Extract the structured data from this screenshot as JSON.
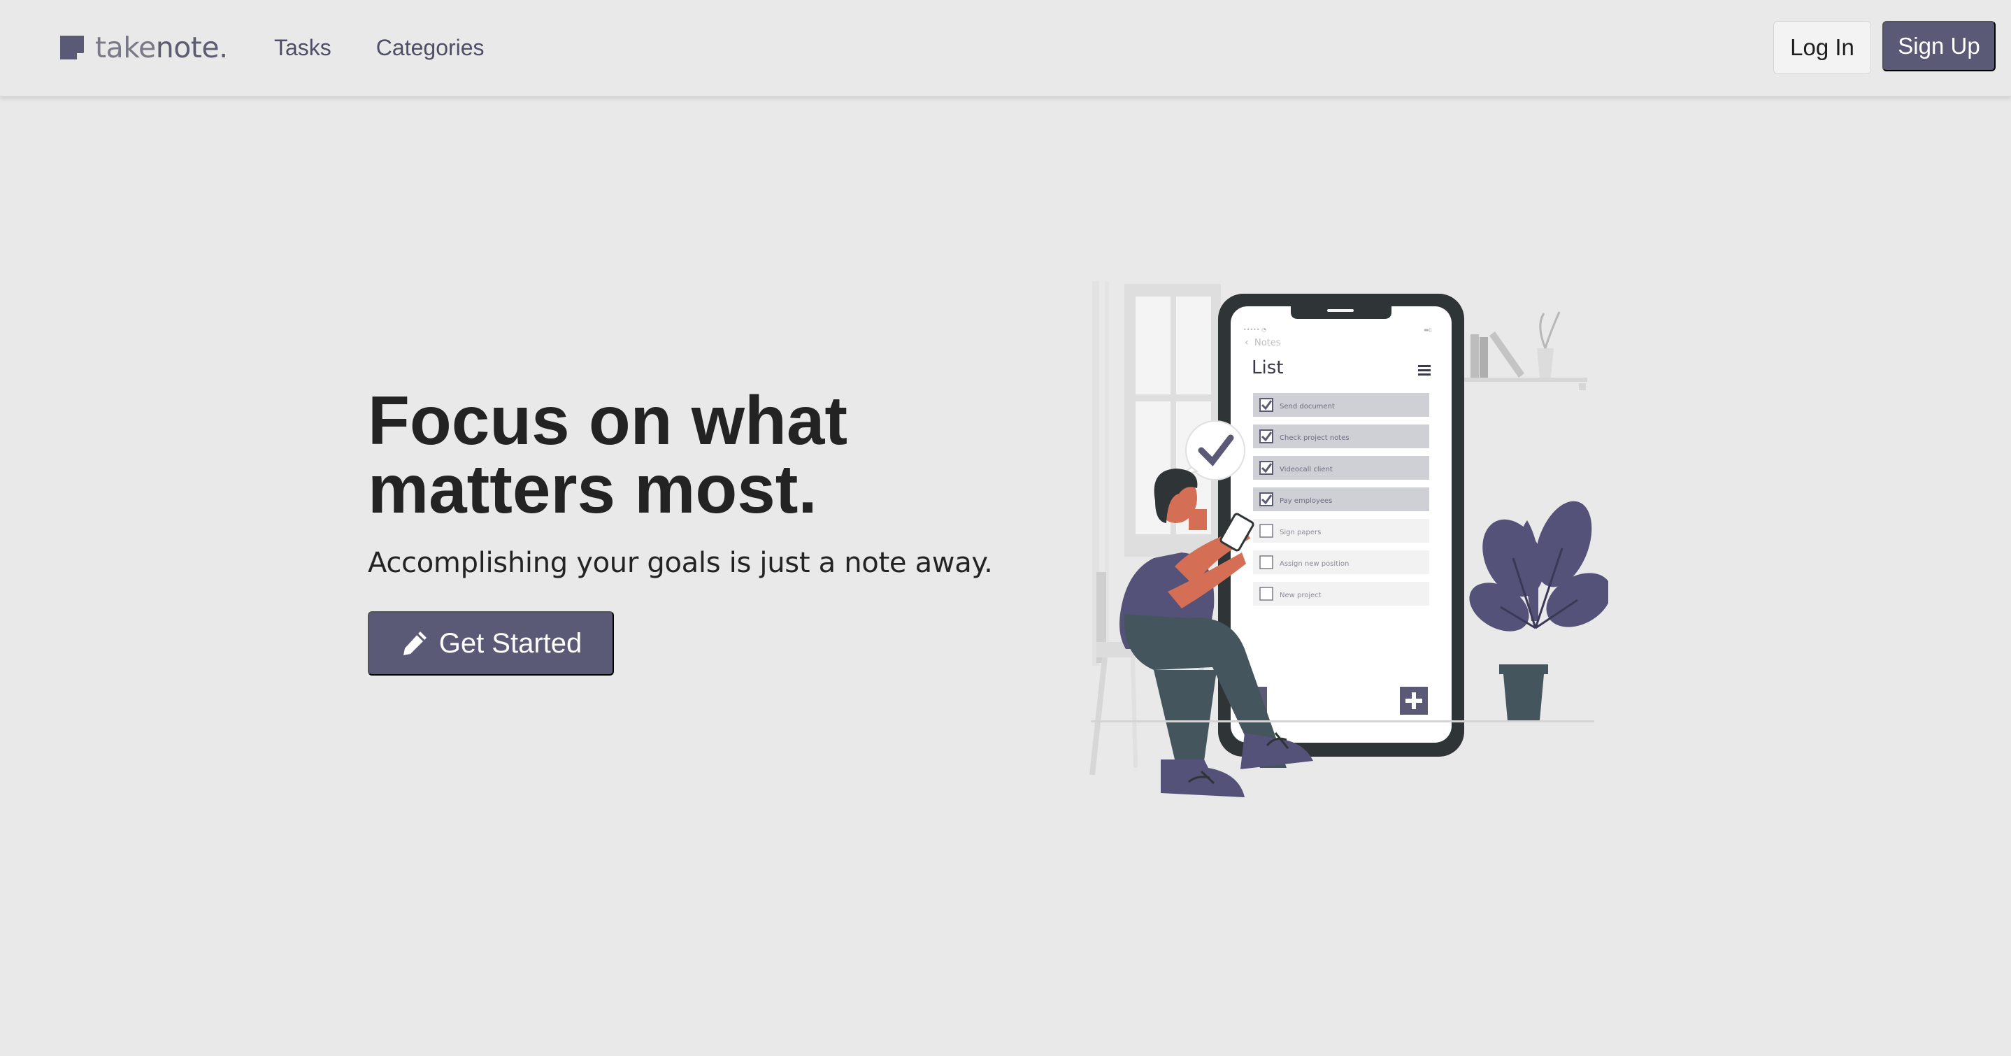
{
  "brand": {
    "light": "take",
    "bold": "note."
  },
  "nav": {
    "links": [
      {
        "label": "Tasks"
      },
      {
        "label": "Categories"
      }
    ]
  },
  "auth": {
    "login_label": "Log In",
    "signup_label": "Sign Up"
  },
  "hero": {
    "title": "Focus on what matters most.",
    "subtitle": "Accomplishing your goals is just a note away.",
    "cta_label": "Get Started",
    "cta_icon": "pencil-icon"
  },
  "illustration": {
    "back_label": "Notes",
    "list_title": "List",
    "tasks": [
      {
        "label": "Send document",
        "done": true
      },
      {
        "label": "Check project notes",
        "done": true
      },
      {
        "label": "Videocall client",
        "done": true
      },
      {
        "label": "Pay employees",
        "done": true
      },
      {
        "label": "Sign papers",
        "done": false
      },
      {
        "label": "Assign new position",
        "done": false
      },
      {
        "label": "New project",
        "done": false
      }
    ]
  },
  "colors": {
    "background": "#e9e9e9",
    "accent": "#5b5a76",
    "text": "#232323",
    "nav_text": "#4e4e66"
  }
}
